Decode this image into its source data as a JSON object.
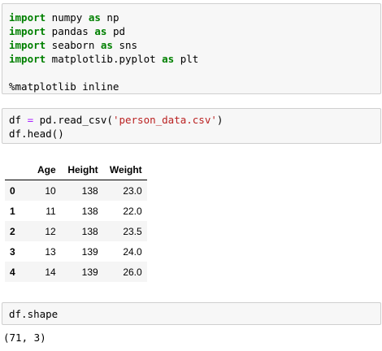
{
  "cell1": {
    "lines": [
      {
        "kw1": "import",
        "mod": " numpy ",
        "kw2": "as",
        "alias": " np"
      },
      {
        "kw1": "import",
        "mod": " pandas ",
        "kw2": "as",
        "alias": " pd"
      },
      {
        "kw1": "import",
        "mod": " seaborn ",
        "kw2": "as",
        "alias": " sns"
      },
      {
        "kw1": "import",
        "mod": " matplotlib.pyplot ",
        "kw2": "as",
        "alias": " plt"
      }
    ],
    "magic": "%matplotlib inline"
  },
  "cell2": {
    "line1_var": "df ",
    "line1_op": "=",
    "line1_call": " pd.read_csv(",
    "line1_str": "'person_data.csv'",
    "line1_close": ")",
    "line2": "df.head()"
  },
  "table": {
    "columns": [
      "Age",
      "Height",
      "Weight"
    ],
    "rows": [
      {
        "index": "0",
        "values": [
          "10",
          "138",
          "23.0"
        ]
      },
      {
        "index": "1",
        "values": [
          "11",
          "138",
          "22.0"
        ]
      },
      {
        "index": "2",
        "values": [
          "12",
          "138",
          "23.5"
        ]
      },
      {
        "index": "3",
        "values": [
          "13",
          "139",
          "24.0"
        ]
      },
      {
        "index": "4",
        "values": [
          "14",
          "139",
          "26.0"
        ]
      }
    ]
  },
  "cell3": {
    "code": "df.shape",
    "output": "(71, 3)"
  }
}
